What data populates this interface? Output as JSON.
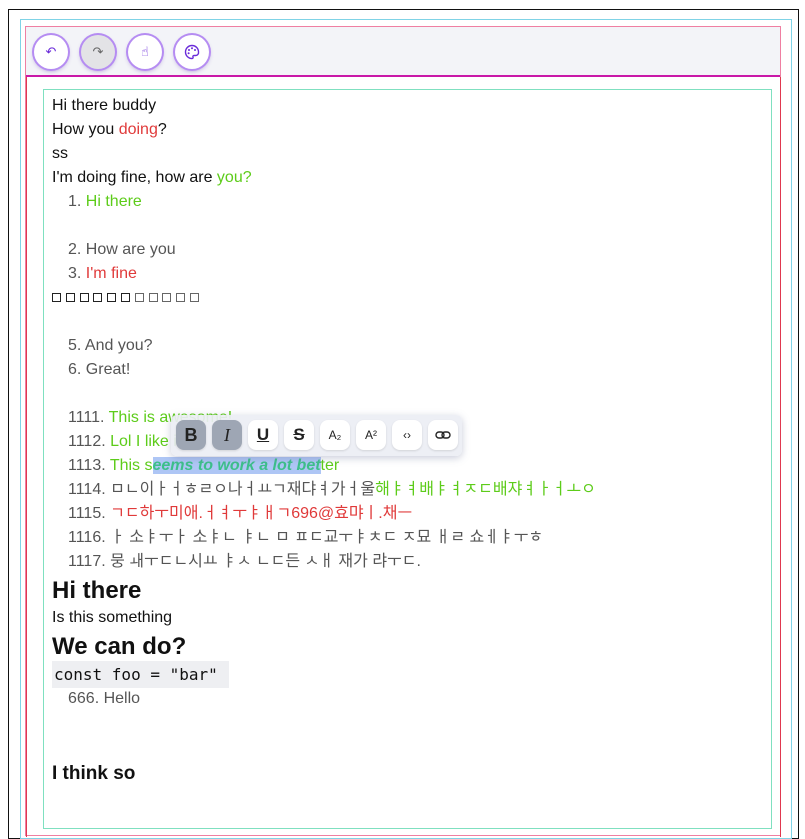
{
  "toolbar": {
    "buttons": [
      {
        "name": "undo",
        "icon": "undo-icon",
        "glyph": "↶"
      },
      {
        "name": "redo",
        "icon": "redo-icon",
        "glyph": "↷"
      },
      {
        "name": "clear-format",
        "icon": "hand-icon",
        "glyph": "☝"
      },
      {
        "name": "theme",
        "icon": "palette-icon",
        "glyph": "◍"
      }
    ]
  },
  "editor": {
    "p1": "Hi there buddy",
    "p2_a": "How you ",
    "p2_b": "doing",
    "p2_c": "?",
    "p3": "ss",
    "p4_a": "I'm doing fine, how are ",
    "p4_b": "you?",
    "list_a": [
      {
        "num": "1.",
        "text": "Hi there"
      },
      {
        "num": "2.",
        "text": "How are you"
      },
      {
        "num": "3.",
        "text": "I'm fine"
      }
    ],
    "list_b": [
      {
        "num": "5.",
        "text": "And you?"
      },
      {
        "num": "6.",
        "text": "Great!"
      }
    ],
    "list_c": [
      {
        "num": "1111.",
        "text": "This is awesome!"
      },
      {
        "num": "1112.",
        "text": "Lol I like it"
      },
      {
        "num": "1113.",
        "text_a": "This s",
        "text_sel": "eems to work a lot bet",
        "text_b": "ter"
      },
      {
        "num": "1114.",
        "text_a": "ㅁㄴ이ㅏㅓㅎㄹㅇ나ㅓㅛㄱ재댜ㅕ가ㅓ울",
        "text_b": "해ㅑㅕ배ㅑㅕㅈㄷ배쟈ㅕㅏㅓㅗㅇ"
      },
      {
        "num": "1115.",
        "text": "ㄱㄷ하ㅜ미애.ㅓㅕㅜㅑㅐㄱ696@효먀ㅣ.채ㅡ"
      },
      {
        "num": "1116.",
        "text": "ㅏ 소ㅑㅜㅏ 소ㅑㄴ ㅑㄴ ㅁ ㅍㄷ교ㅜㅑㅊㄷ ㅈ묘 ㅐㄹ 쇼ㅔㅑㅜㅎ"
      },
      {
        "num": "1117.",
        "text": "뭉 ㅙㅜㄷㄴ시ㅛ ㅑㅅ ㄴㄷ든 ㅅㅐ 재가 랴ㅜㄷ."
      }
    ],
    "h1_a": "Hi there",
    "p5": "Is this something",
    "h1_b": "We can do?",
    "code": "const foo = \"bar\"",
    "list_d": [
      {
        "num": "666.",
        "text": "Hello"
      }
    ],
    "h3": "I think so"
  },
  "format_bar": {
    "bold": "B",
    "italic": "I",
    "underline": "U",
    "strike": "S",
    "subscript": "A₂",
    "superscript": "A²",
    "code": "‹›",
    "link": "⊘"
  },
  "colors": {
    "accent": "#6a2bd9",
    "red": "#e03a3a",
    "green": "#5dcc1a",
    "selection": "#aec6f5"
  }
}
